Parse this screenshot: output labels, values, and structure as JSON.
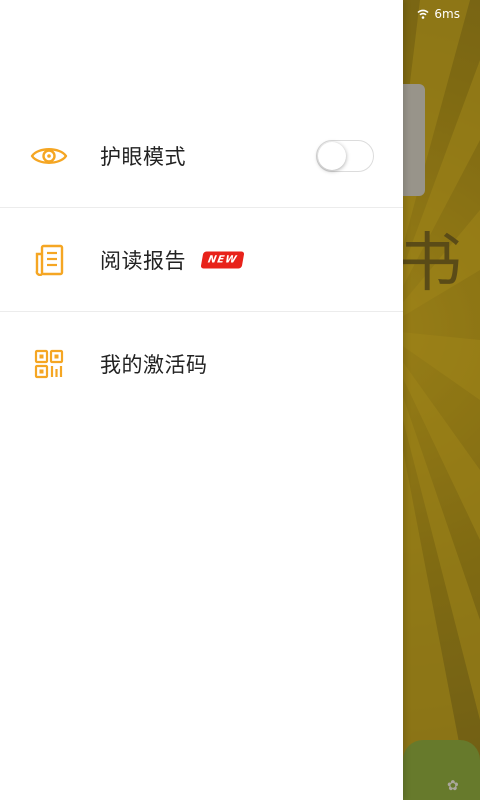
{
  "status_bar": {
    "ping": "6ms",
    "wifi_icon": "wifi-icon"
  },
  "background": {
    "partial_char": "书"
  },
  "drawer": {
    "items": [
      {
        "label": "护眼模式",
        "icon": "eye-icon",
        "toggle": {
          "on": false
        }
      },
      {
        "label": "阅读报告",
        "icon": "report-icon",
        "badge": "NEW"
      },
      {
        "label": "我的激活码",
        "icon": "qr-code-icon"
      }
    ]
  },
  "colors": {
    "accent": "#f5a623",
    "badge": "#e8221a",
    "text": "#222222"
  }
}
